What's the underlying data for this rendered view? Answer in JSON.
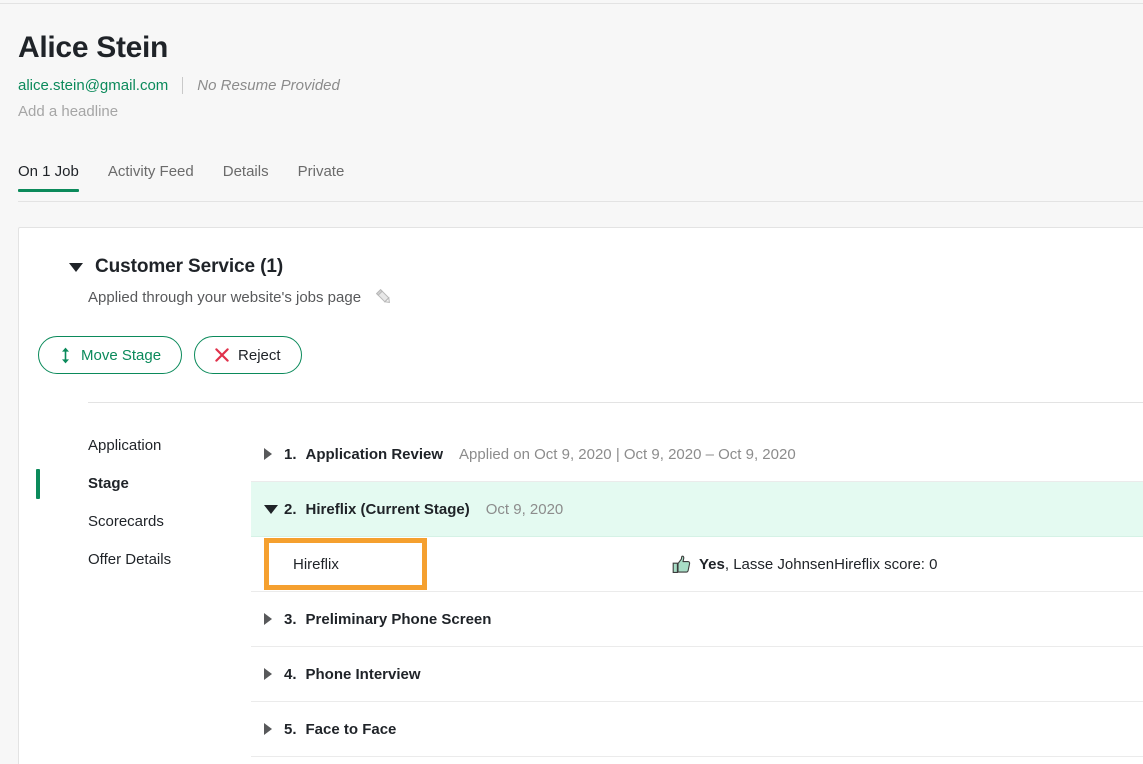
{
  "candidate": {
    "name": "Alice Stein",
    "email": "alice.stein@gmail.com",
    "resume_status": "No Resume Provided",
    "headline_placeholder": "Add a headline"
  },
  "tabs": [
    {
      "label": "On 1 Job",
      "active": true
    },
    {
      "label": "Activity Feed",
      "active": false
    },
    {
      "label": "Details",
      "active": false
    },
    {
      "label": "Private",
      "active": false
    }
  ],
  "job": {
    "title": "Customer Service (1)",
    "source": "Applied through your website's jobs page",
    "edit_icon": "pencil-icon",
    "collapse_icon": "triangle-down-icon"
  },
  "actions": {
    "move_stage": {
      "label": "Move Stage",
      "icon": "up-down-arrow-icon"
    },
    "reject": {
      "label": "Reject",
      "icon": "x-icon"
    }
  },
  "subnav": {
    "items": [
      {
        "label": "Application",
        "active": false
      },
      {
        "label": "Stage",
        "active": true
      },
      {
        "label": "Scorecards",
        "active": false
      },
      {
        "label": "Offer Details",
        "active": false
      }
    ]
  },
  "stages": [
    {
      "number": "1.",
      "name": "Application Review",
      "dates": "Applied on Oct 9, 2020 | Oct 9, 2020 – Oct 9, 2020",
      "expanded": false,
      "current": false
    },
    {
      "number": "2.",
      "name": "Hireflix (Current Stage)",
      "dates": "Oct 9, 2020",
      "expanded": true,
      "current": true
    },
    {
      "number": "3.",
      "name": "Preliminary Phone Screen",
      "dates": "",
      "expanded": false,
      "current": false
    },
    {
      "number": "4.",
      "name": "Phone Interview",
      "dates": "",
      "expanded": false,
      "current": false
    },
    {
      "number": "5.",
      "name": "Face to Face",
      "dates": "",
      "expanded": false,
      "current": false
    }
  ],
  "interview": {
    "name": "Hireflix",
    "verdict_bold": "Yes",
    "verdict_rest": ", Lasse JohnsenHireflix score: 0",
    "thumb_icon": "thumbs-up-icon",
    "highlight_color": "#f5a02f"
  },
  "colors": {
    "brand_green": "#0b8a5b",
    "reject_red": "#e0314b",
    "current_stage_bg": "#e4faf1",
    "highlight_orange": "#f5a02f",
    "page_bg": "#f7f7f7"
  }
}
